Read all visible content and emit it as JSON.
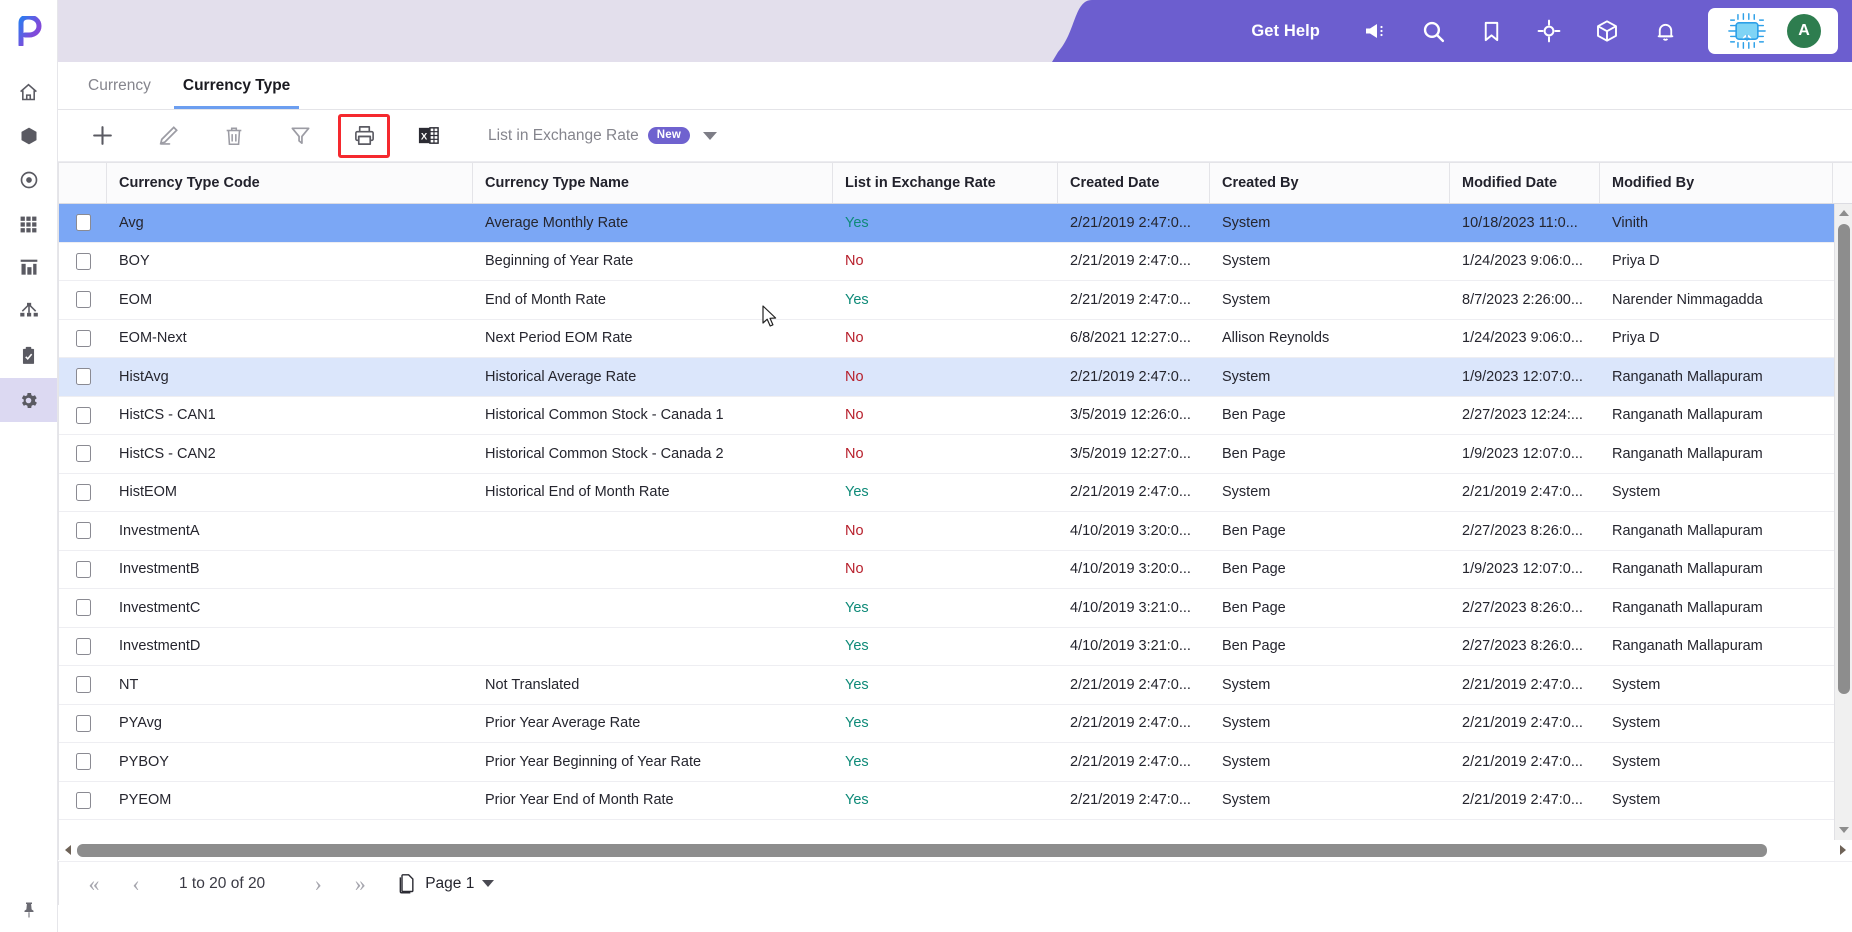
{
  "app": {
    "logo_icon": "p-logo-icon"
  },
  "sidebar": {
    "items": [
      {
        "name": "home",
        "icon": "home-icon"
      },
      {
        "name": "cube",
        "icon": "cube-icon"
      },
      {
        "name": "target",
        "icon": "target-circle-icon"
      },
      {
        "name": "apps",
        "icon": "grid-apps-icon"
      },
      {
        "name": "reports",
        "icon": "bar-chart-icon"
      },
      {
        "name": "hierarchy",
        "icon": "hierarchy-icon"
      },
      {
        "name": "tasks",
        "icon": "clipboard-check-icon"
      },
      {
        "name": "settings",
        "icon": "gear-icon",
        "active": true
      }
    ],
    "pin_icon": "pin-icon"
  },
  "topbar": {
    "get_help": "Get Help",
    "icons": [
      {
        "name": "announcement-icon"
      },
      {
        "name": "search-icon"
      },
      {
        "name": "bookmark-icon"
      },
      {
        "name": "target-crosshair-icon"
      },
      {
        "name": "package-icon"
      },
      {
        "name": "bell-icon"
      }
    ],
    "ai_chip_icon": "ai-chip-icon",
    "avatar_initial": "A",
    "purple": "#6c5ecf",
    "band": "#e3dfec",
    "avatar_color": "#2e7d4f"
  },
  "tabs": [
    {
      "label": "Currency",
      "active": false
    },
    {
      "label": "Currency Type",
      "active": true
    }
  ],
  "toolbar": {
    "buttons": [
      {
        "name": "add-button",
        "icon": "plus-icon",
        "state": "enabled"
      },
      {
        "name": "edit-button",
        "icon": "pencil-icon",
        "state": "disabled"
      },
      {
        "name": "delete-button",
        "icon": "trash-icon",
        "state": "disabled"
      },
      {
        "name": "filter-button",
        "icon": "funnel-icon",
        "state": "disabled"
      },
      {
        "name": "print-button",
        "icon": "printer-icon",
        "state": "highlighted"
      },
      {
        "name": "export-excel-button",
        "icon": "excel-icon",
        "state": "enabled"
      }
    ],
    "view_label": "List in Exchange Rate",
    "view_badge": "New",
    "highlight_color": "#f5292e"
  },
  "grid": {
    "columns": [
      "Currency Type Code",
      "Currency Type Name",
      "List in Exchange Rate",
      "Created Date",
      "Created By",
      "Modified Date",
      "Modified By"
    ],
    "rows": [
      {
        "code": "Avg",
        "name": "Average Monthly Rate",
        "list": "Yes",
        "created": "2/21/2019 2:47:0...",
        "created_by": "System",
        "modified": "10/18/2023 11:0...",
        "modified_by": "Vinith",
        "highlight": "strong"
      },
      {
        "code": "BOY",
        "name": "Beginning of Year Rate",
        "list": "No",
        "created": "2/21/2019 2:47:0...",
        "created_by": "System",
        "modified": "1/24/2023 9:06:0...",
        "modified_by": "Priya D",
        "highlight": "none"
      },
      {
        "code": "EOM",
        "name": "End of Month Rate",
        "list": "Yes",
        "created": "2/21/2019 2:47:0...",
        "created_by": "System",
        "modified": "8/7/2023 2:26:00...",
        "modified_by": "Narender Nimmagadda",
        "highlight": "none"
      },
      {
        "code": "EOM-Next",
        "name": "Next Period EOM Rate",
        "list": "No",
        "created": "6/8/2021 12:27:0...",
        "created_by": "Allison Reynolds",
        "modified": "1/24/2023 9:06:0...",
        "modified_by": "Priya D",
        "highlight": "none"
      },
      {
        "code": "HistAvg",
        "name": "Historical Average Rate",
        "list": "No",
        "created": "2/21/2019 2:47:0...",
        "created_by": "System",
        "modified": "1/9/2023 12:07:0...",
        "modified_by": "Ranganath Mallapuram",
        "highlight": "light"
      },
      {
        "code": "HistCS - CAN1",
        "name": "Historical Common Stock - Canada 1",
        "list": "No",
        "created": "3/5/2019 12:26:0...",
        "created_by": "Ben Page",
        "modified": "2/27/2023 12:24:...",
        "modified_by": "Ranganath Mallapuram",
        "highlight": "none"
      },
      {
        "code": "HistCS - CAN2",
        "name": "Historical Common Stock - Canada 2",
        "list": "No",
        "created": "3/5/2019 12:27:0...",
        "created_by": "Ben Page",
        "modified": "1/9/2023 12:07:0...",
        "modified_by": "Ranganath Mallapuram",
        "highlight": "none"
      },
      {
        "code": "HistEOM",
        "name": "Historical End of Month Rate",
        "list": "Yes",
        "created": "2/21/2019 2:47:0...",
        "created_by": "System",
        "modified": "2/21/2019 2:47:0...",
        "modified_by": "System",
        "highlight": "none"
      },
      {
        "code": "InvestmentA",
        "name": "",
        "list": "No",
        "created": "4/10/2019 3:20:0...",
        "created_by": "Ben Page",
        "modified": "2/27/2023 8:26:0...",
        "modified_by": "Ranganath Mallapuram",
        "highlight": "none"
      },
      {
        "code": "InvestmentB",
        "name": "",
        "list": "No",
        "created": "4/10/2019 3:20:0...",
        "created_by": "Ben Page",
        "modified": "1/9/2023 12:07:0...",
        "modified_by": "Ranganath Mallapuram",
        "highlight": "none"
      },
      {
        "code": "InvestmentC",
        "name": "",
        "list": "Yes",
        "created": "4/10/2019 3:21:0...",
        "created_by": "Ben Page",
        "modified": "2/27/2023 8:26:0...",
        "modified_by": "Ranganath Mallapuram",
        "highlight": "none"
      },
      {
        "code": "InvestmentD",
        "name": "",
        "list": "Yes",
        "created": "4/10/2019 3:21:0...",
        "created_by": "Ben Page",
        "modified": "2/27/2023 8:26:0...",
        "modified_by": "Ranganath Mallapuram",
        "highlight": "none"
      },
      {
        "code": "NT",
        "name": "Not Translated",
        "list": "Yes",
        "created": "2/21/2019 2:47:0...",
        "created_by": "System",
        "modified": "2/21/2019 2:47:0...",
        "modified_by": "System",
        "highlight": "none"
      },
      {
        "code": "PYAvg",
        "name": "Prior Year Average Rate",
        "list": "Yes",
        "created": "2/21/2019 2:47:0...",
        "created_by": "System",
        "modified": "2/21/2019 2:47:0...",
        "modified_by": "System",
        "highlight": "none"
      },
      {
        "code": "PYBOY",
        "name": "Prior Year Beginning of Year Rate",
        "list": "Yes",
        "created": "2/21/2019 2:47:0...",
        "created_by": "System",
        "modified": "2/21/2019 2:47:0...",
        "modified_by": "System",
        "highlight": "none"
      },
      {
        "code": "PYEOM",
        "name": "Prior Year End of Month Rate",
        "list": "Yes",
        "created": "2/21/2019 2:47:0...",
        "created_by": "System",
        "modified": "2/21/2019 2:47:0...",
        "modified_by": "System",
        "highlight": "none"
      }
    ],
    "yes_color": "#0e8a78",
    "no_color": "#b7202c",
    "selected_row_color": "#7ba7f5",
    "hover_row_color": "#dbe6fb"
  },
  "pager": {
    "first_icon": "double-chevron-left-icon",
    "prev_icon": "chevron-left-icon",
    "range": "1 to 20 of 20",
    "next_icon": "chevron-right-icon",
    "last_icon": "double-chevron-right-icon",
    "page_icon": "page-copy-icon",
    "page_label": "Page 1"
  }
}
